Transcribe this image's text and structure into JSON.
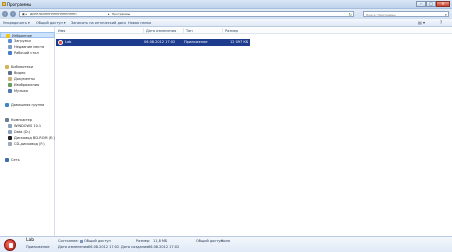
{
  "window": {
    "title": "Программы",
    "buttons": [
      "–",
      "□",
      "✕"
    ]
  },
  "address": {
    "crumb_user": "ДИГЕЛЬННННННННННННННН",
    "crumb_folder": "Программы",
    "refresh_icon": "refresh-icon"
  },
  "search": {
    "placeholder": "Поиск: Программы"
  },
  "toolbar": {
    "organize": "Упорядочить ▾",
    "share": "Общий доступ ▾",
    "burn": "Записать на оптический диск",
    "new_folder": "Новая папка",
    "views_icon": "▤ ▾",
    "help_icon": "?"
  },
  "sidebar": {
    "favorites": [
      {
        "label": "Избранное"
      },
      {
        "label": "Загрузки"
      },
      {
        "label": "Недавние места"
      },
      {
        "label": "Рабочий стол"
      }
    ],
    "libraries": [
      {
        "label": "Библиотеки"
      },
      {
        "label": "Видео"
      },
      {
        "label": "Документы"
      },
      {
        "label": "Изображения"
      },
      {
        "label": "Музыка"
      }
    ],
    "homegroup": "Домашняя группа",
    "computer": [
      {
        "label": "Компьютер"
      },
      {
        "label": "WINDOWS 10.1"
      },
      {
        "label": "Data (D:)"
      },
      {
        "label": "Дисковод BD-ROM (E:)"
      },
      {
        "label": "CD-дисковод (F:)"
      }
    ],
    "network": "Сеть"
  },
  "columns": [
    "Имя",
    "Дата изменения",
    "Тип",
    "Размер"
  ],
  "files": [
    {
      "name": "Lab",
      "modified": "06.08.2012 17:02",
      "type": "Приложение",
      "size": "12 097 КБ"
    }
  ],
  "details": {
    "name": "Lab",
    "kind": "Приложение",
    "modified_label": "Дата изменения:",
    "modified": "06.08.2012 17:02",
    "state_label": "Состояние:",
    "state": "Общий доступ",
    "size_label": "Размер:",
    "size": "11,8 МБ",
    "created_label": "Дата создания:",
    "created": "06.08.2012 17:02",
    "shared_label": "Общий доступ:",
    "shared": "Коля"
  },
  "colors": {
    "selection": "#1d3c8d",
    "accent": "#cde3fb"
  }
}
